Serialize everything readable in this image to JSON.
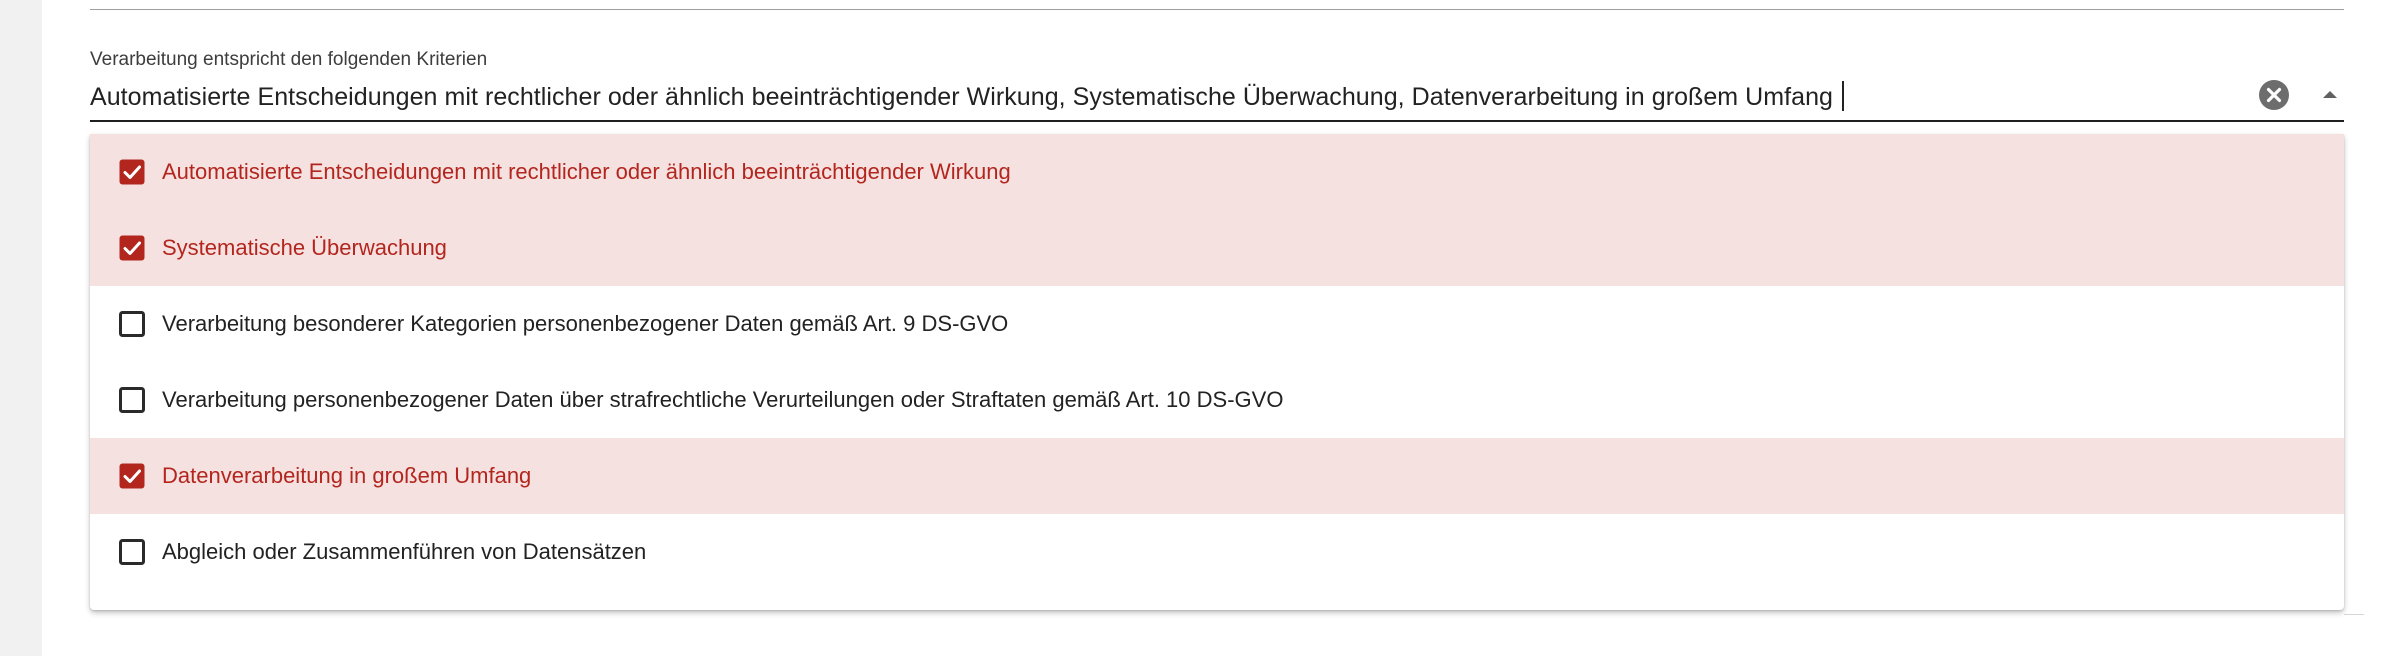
{
  "field": {
    "label": "Verarbeitung entspricht den folgenden Kriterien",
    "value": "Automatisierte Entscheidungen mit rechtlicher oder ähnlich beeinträchtigender Wirkung, Systematische Überwachung, Datenverarbeitung in großem Umfang"
  },
  "icons": {
    "clear": "clear-circle-icon",
    "toggle": "arrow-drop-up-icon",
    "checked": "checkbox-checked-icon",
    "unchecked": "checkbox-unchecked-icon"
  },
  "colors": {
    "accent": "#b3261e",
    "selected_row_bg": "#f6e1e1",
    "text": "#222222"
  },
  "options": [
    {
      "label": "Automatisierte Entscheidungen mit rechtlicher oder ähnlich beeinträchtigender Wirkung",
      "checked": true
    },
    {
      "label": "Systematische Überwachung",
      "checked": true
    },
    {
      "label": "Verarbeitung besonderer Kategorien personenbezogener Daten gemäß Art. 9 DS-GVO",
      "checked": false
    },
    {
      "label": "Verarbeitung personenbezogener Daten über strafrechtliche Verurteilungen oder Straftaten gemäß Art. 10 DS-GVO",
      "checked": false
    },
    {
      "label": "Datenverarbeitung in großem Umfang",
      "checked": true
    },
    {
      "label": "Abgleich oder Zusammenführen von Datensätzen",
      "checked": false
    }
  ]
}
